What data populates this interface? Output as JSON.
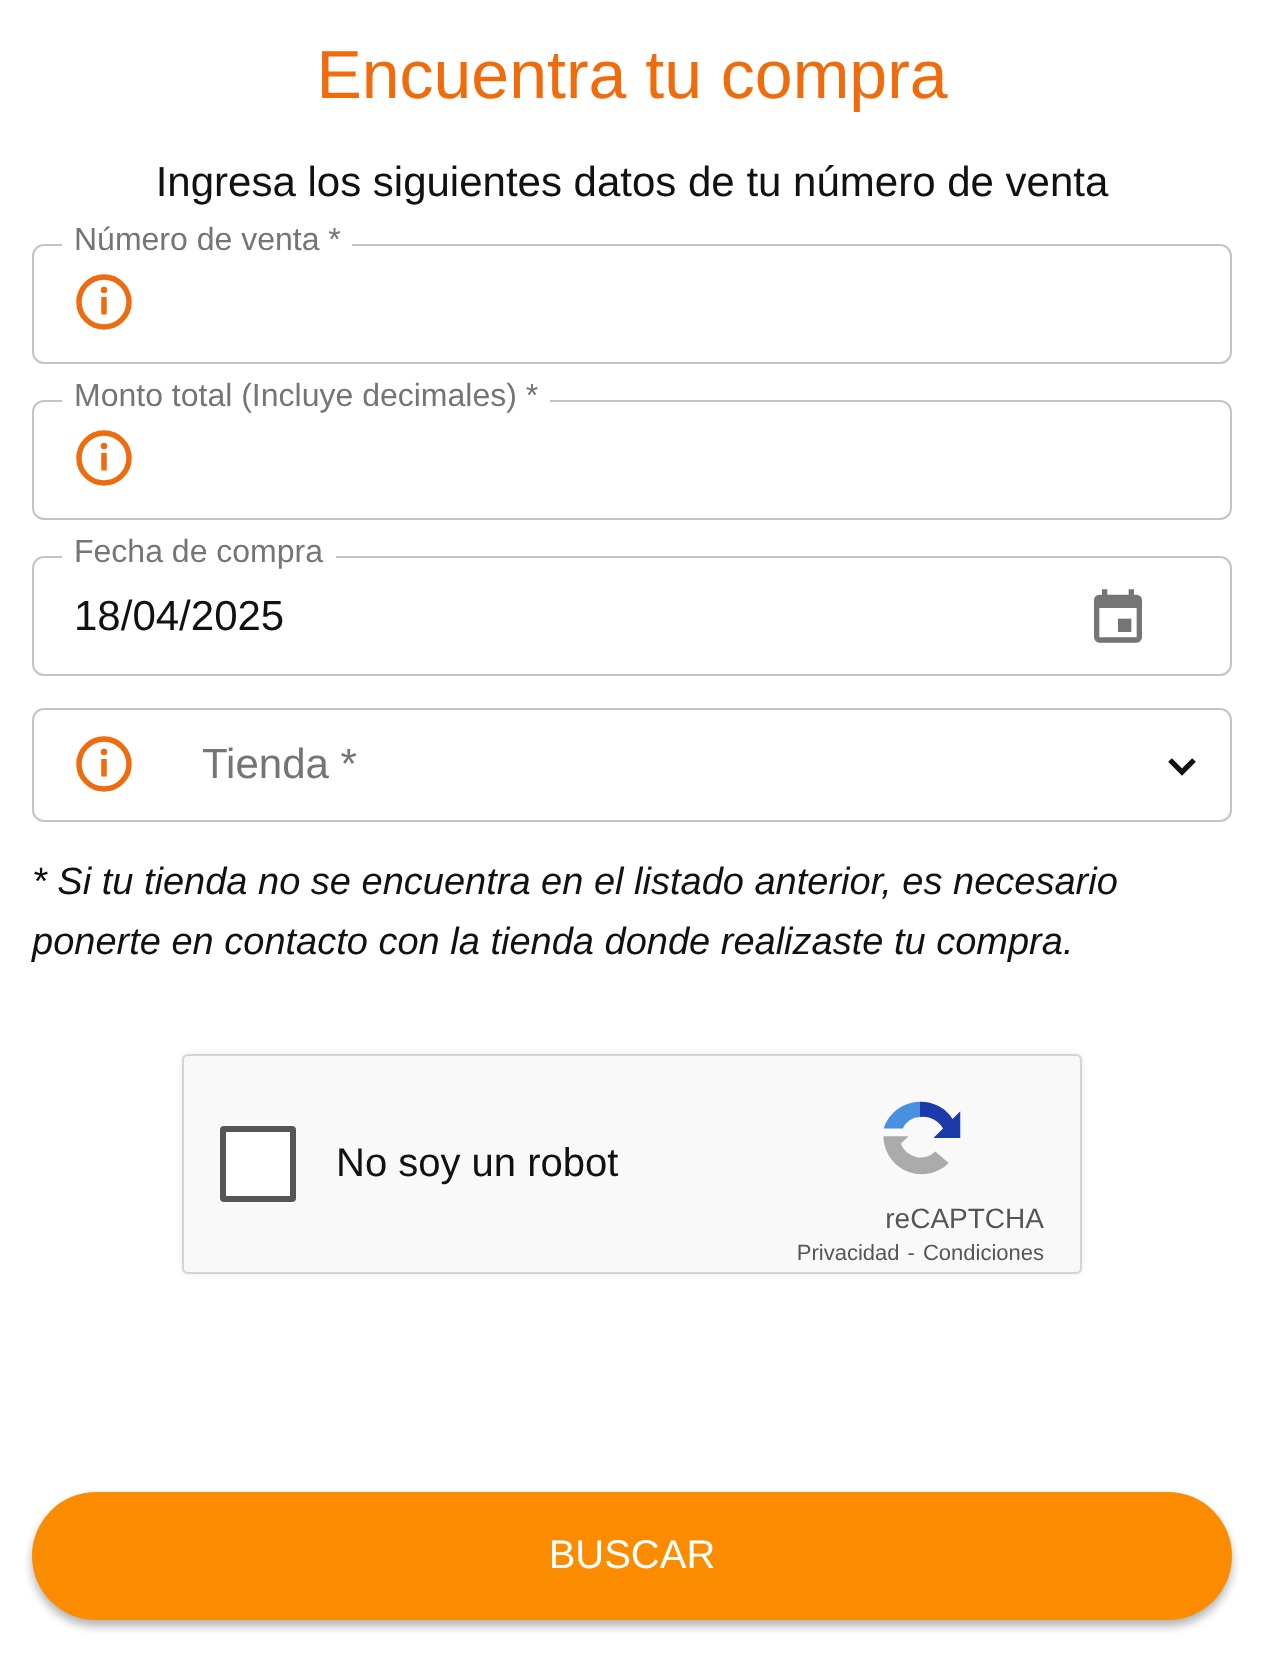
{
  "title": "Encuentra tu compra",
  "subtitle": "Ingresa los siguientes datos de tu número de venta",
  "fields": [
    {
      "kind": "text",
      "label": "Número de venta *",
      "invalid": true
    },
    {
      "kind": "text",
      "label": "Monto total (Incluye decimales) *",
      "invalid": true
    },
    {
      "kind": "date",
      "label": "Fecha de compra",
      "value": "18/04/2025",
      "invalid": false
    },
    {
      "kind": "select",
      "placeholder": "Tienda *",
      "invalid": true
    }
  ],
  "note": "* Si tu tienda no se encuentra en el listado anterior, es necesario ponerte en contacto con la tienda donde realizaste tu compra.",
  "captcha": {
    "label": "No soy un robot",
    "checked": false,
    "brand": "reCAPTCHA",
    "links": [
      "Privacidad",
      "Condiciones"
    ],
    "separator": "-"
  },
  "button": "BUSCAR"
}
